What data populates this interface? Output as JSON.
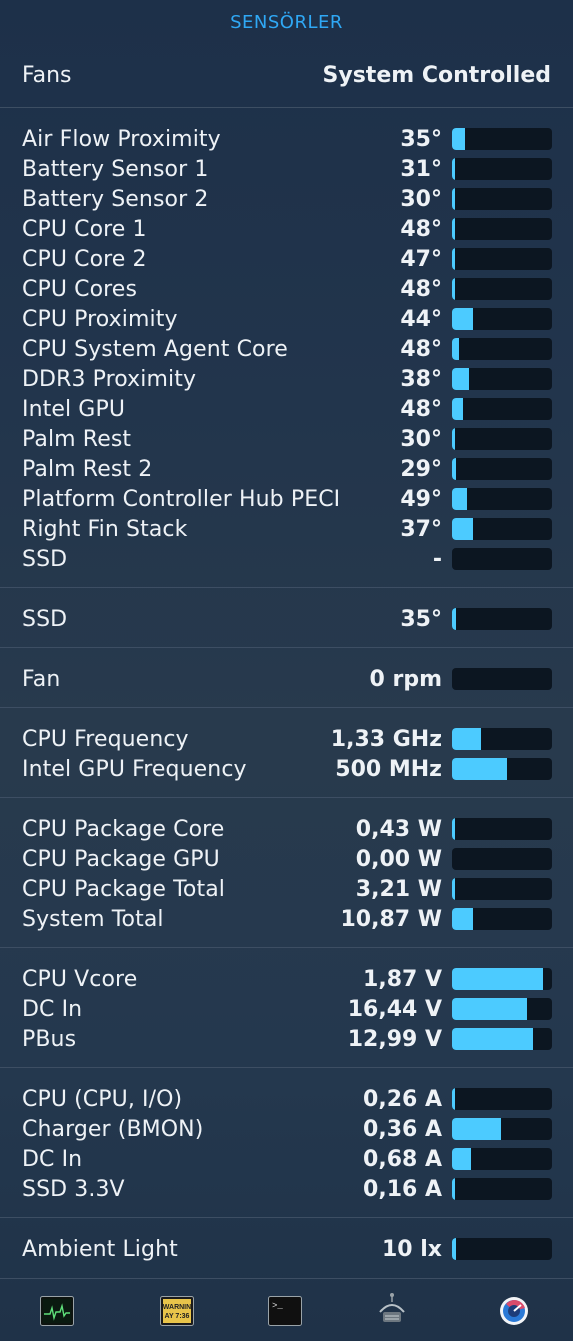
{
  "header": {
    "title": "SENSÖRLER"
  },
  "fans": {
    "label": "Fans",
    "value": "System Controlled"
  },
  "sections": [
    {
      "id": "temperatures",
      "rows": [
        {
          "name": "Air Flow Proximity",
          "value": "35°",
          "level": 0.13
        },
        {
          "name": "Battery Sensor 1",
          "value": "31°",
          "level": 0.02
        },
        {
          "name": "Battery Sensor 2",
          "value": "30°",
          "level": 0.02
        },
        {
          "name": "CPU Core 1",
          "value": "48°",
          "level": 0.02
        },
        {
          "name": "CPU Core 2",
          "value": "47°",
          "level": 0.02
        },
        {
          "name": "CPU Cores",
          "value": "48°",
          "level": 0.02
        },
        {
          "name": "CPU Proximity",
          "value": "44°",
          "level": 0.21
        },
        {
          "name": "CPU System Agent Core",
          "value": "48°",
          "level": 0.07
        },
        {
          "name": "DDR3 Proximity",
          "value": "38°",
          "level": 0.17
        },
        {
          "name": "Intel GPU",
          "value": "48°",
          "level": 0.11
        },
        {
          "name": "Palm Rest",
          "value": "30°",
          "level": 0.03
        },
        {
          "name": "Palm Rest 2",
          "value": "29°",
          "level": 0.04
        },
        {
          "name": "Platform Controller Hub PECI",
          "value": "49°",
          "level": 0.15
        },
        {
          "name": "Right Fin Stack",
          "value": "37°",
          "level": 0.21
        },
        {
          "name": "SSD",
          "value": "-",
          "level": 0
        }
      ]
    },
    {
      "id": "ssd",
      "rows": [
        {
          "name": "SSD",
          "value": "35°",
          "level": 0.04
        }
      ]
    },
    {
      "id": "fan",
      "rows": [
        {
          "name": "Fan",
          "value": "0 rpm",
          "level": 0
        }
      ]
    },
    {
      "id": "frequency",
      "rows": [
        {
          "name": "CPU Frequency",
          "value": "1,33 GHz",
          "level": 0.29
        },
        {
          "name": "Intel GPU Frequency",
          "value": "500 MHz",
          "level": 0.55
        }
      ]
    },
    {
      "id": "power",
      "rows": [
        {
          "name": "CPU Package Core",
          "value": "0,43 W",
          "level": 0.02
        },
        {
          "name": "CPU Package GPU",
          "value": "0,00 W",
          "level": 0
        },
        {
          "name": "CPU Package Total",
          "value": "3,21 W",
          "level": 0.03
        },
        {
          "name": "System Total",
          "value": "10,87 W",
          "level": 0.21
        }
      ]
    },
    {
      "id": "voltage",
      "rows": [
        {
          "name": "CPU Vcore",
          "value": "1,87 V",
          "level": 0.91
        },
        {
          "name": "DC In",
          "value": "16,44 V",
          "level": 0.75
        },
        {
          "name": "PBus",
          "value": "12,99 V",
          "level": 0.81
        }
      ]
    },
    {
      "id": "current",
      "rows": [
        {
          "name": "CPU (CPU, I/O)",
          "value": "0,26 A",
          "level": 0.02
        },
        {
          "name": "Charger (BMON)",
          "value": "0,36 A",
          "level": 0.49
        },
        {
          "name": "DC In",
          "value": "0,68 A",
          "level": 0.19
        },
        {
          "name": "SSD 3.3V",
          "value": "0,16 A",
          "level": 0.02
        }
      ]
    },
    {
      "id": "light",
      "rows": [
        {
          "name": "Ambient Light",
          "value": "10 lx",
          "level": 0.04
        }
      ]
    }
  ],
  "dock": {
    "items": [
      {
        "icon": "activity-monitor-icon"
      },
      {
        "icon": "console-icon",
        "text_line1": "WARNIN",
        "text_line2": "AY 7:36"
      },
      {
        "icon": "terminal-icon",
        "text": ">_"
      },
      {
        "icon": "system-information-icon"
      },
      {
        "icon": "istat-menus-icon"
      }
    ]
  },
  "colors": {
    "accent": "#2fa8f5",
    "bar_fill": "#4ccbff",
    "bar_track": "#0c1621",
    "divider": "#3d4e63"
  }
}
